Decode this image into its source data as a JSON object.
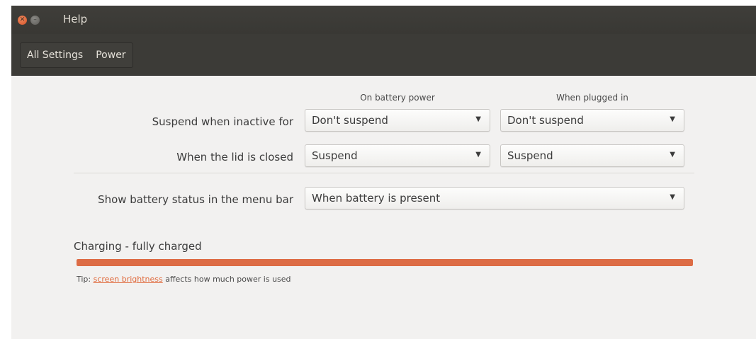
{
  "window": {
    "title": "Help",
    "controls": {
      "close_icon": "close-icon",
      "minimize_icon": "minimize-icon"
    }
  },
  "toolbar": {
    "breadcrumbs": [
      "All Settings",
      "Power"
    ]
  },
  "columns": {
    "battery": "On battery power",
    "plugged": "When plugged in"
  },
  "settings": {
    "suspend": {
      "label": "Suspend when inactive for",
      "battery_value": "Don't suspend",
      "plugged_value": "Don't suspend"
    },
    "lid": {
      "label": "When the lid is closed",
      "battery_value": "Suspend",
      "plugged_value": "Suspend"
    },
    "battery_status": {
      "label": "Show battery status in the menu bar",
      "value": "When battery is present"
    }
  },
  "battery": {
    "status": "Charging - fully charged",
    "level": 1.0
  },
  "tip": {
    "prefix": "Tip: ",
    "link": "screen brightness",
    "suffix": " affects how much power is used"
  },
  "colors": {
    "accent": "#dd6c45",
    "titlebar": "#3c3b37",
    "background": "#f2f1f0"
  }
}
